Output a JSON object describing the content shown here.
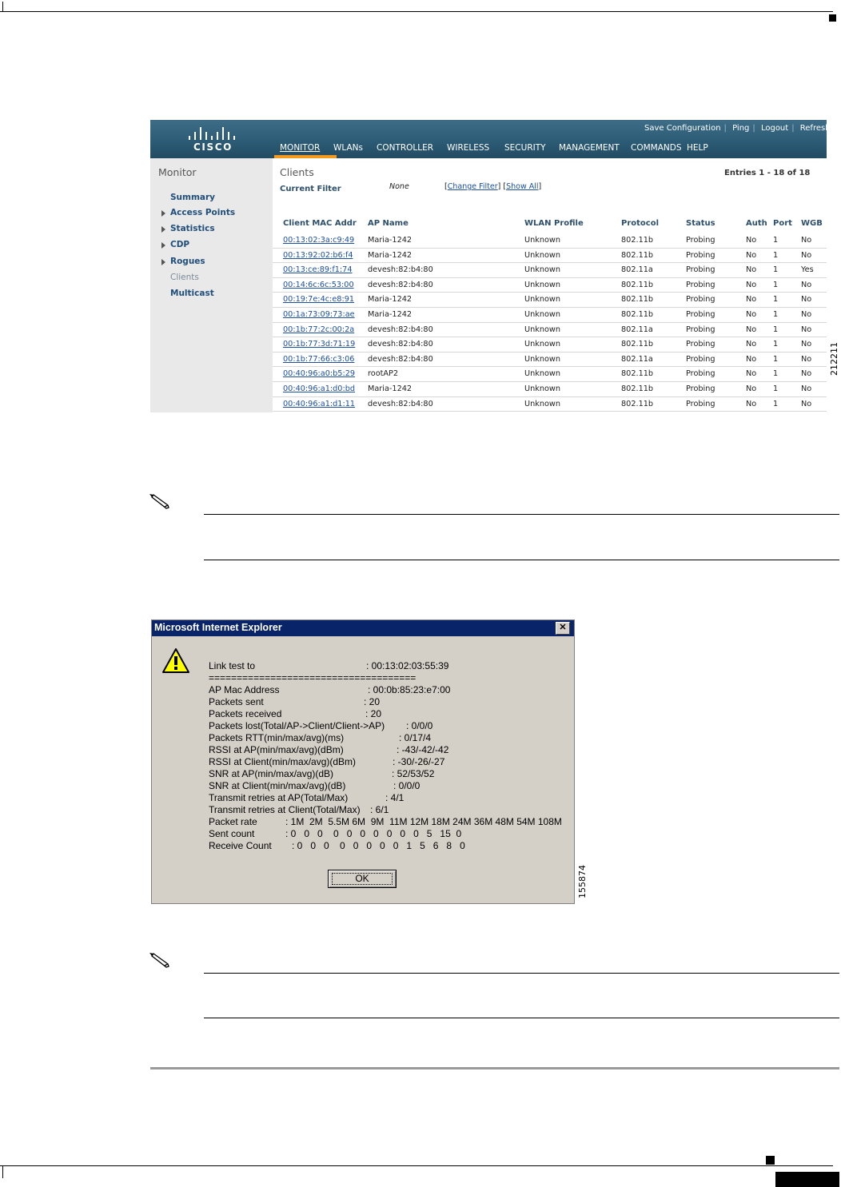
{
  "wlc": {
    "logo_text": "CISCO",
    "top_links": [
      "Save Configuration",
      "Ping",
      "Logout",
      "Refresh"
    ],
    "nav": [
      "MONITOR",
      "WLANs",
      "CONTROLLER",
      "WIRELESS",
      "SECURITY",
      "MANAGEMENT",
      "COMMANDS",
      "HELP"
    ],
    "sidebar": {
      "title": "Monitor",
      "items": [
        "Summary",
        "Access Points",
        "Statistics",
        "CDP",
        "Rogues",
        "Clients",
        "Multicast"
      ]
    },
    "main": {
      "title": "Clients",
      "entries": "Entries 1 - 18 of 18",
      "current_filter_label": "Current Filter",
      "current_filter_value": "None",
      "change_filter": "Change Filter",
      "show_all": "Show All"
    },
    "table": {
      "headers": [
        "Client MAC Addr",
        "AP Name",
        "WLAN Profile",
        "Protocol",
        "Status",
        "Auth",
        "Port",
        "WGB"
      ],
      "rows": [
        [
          "00:13:02:3a:c9:49",
          "Maria-1242",
          "Unknown",
          "802.11b",
          "Probing",
          "No",
          "1",
          "No"
        ],
        [
          "00:13:92:02:b6:f4",
          "Maria-1242",
          "Unknown",
          "802.11b",
          "Probing",
          "No",
          "1",
          "No"
        ],
        [
          "00:13:ce:89:f1:74",
          "devesh:82:b4:80",
          "Unknown",
          "802.11a",
          "Probing",
          "No",
          "1",
          "Yes"
        ],
        [
          "00:14:6c:6c:53:00",
          "devesh:82:b4:80",
          "Unknown",
          "802.11b",
          "Probing",
          "No",
          "1",
          "No"
        ],
        [
          "00:19:7e:4c:e8:91",
          "Maria-1242",
          "Unknown",
          "802.11b",
          "Probing",
          "No",
          "1",
          "No"
        ],
        [
          "00:1a:73:09:73:ae",
          "Maria-1242",
          "Unknown",
          "802.11b",
          "Probing",
          "No",
          "1",
          "No"
        ],
        [
          "00:1b:77:2c:00:2a",
          "devesh:82:b4:80",
          "Unknown",
          "802.11a",
          "Probing",
          "No",
          "1",
          "No"
        ],
        [
          "00:1b:77:3d:71:19",
          "devesh:82:b4:80",
          "Unknown",
          "802.11b",
          "Probing",
          "No",
          "1",
          "No"
        ],
        [
          "00:1b:77:66:c3:06",
          "devesh:82:b4:80",
          "Unknown",
          "802.11a",
          "Probing",
          "No",
          "1",
          "No"
        ],
        [
          "00:40:96:a0:b5:29",
          "rootAP2",
          "Unknown",
          "802.11b",
          "Probing",
          "No",
          "1",
          "No"
        ],
        [
          "00:40:96:a1:d0:bd",
          "Maria-1242",
          "Unknown",
          "802.11b",
          "Probing",
          "No",
          "1",
          "No"
        ],
        [
          "00:40:96:a1:d1:11",
          "devesh:82:b4:80",
          "Unknown",
          "802.11b",
          "Probing",
          "No",
          "1",
          "No"
        ]
      ]
    },
    "figure_number": "212211"
  },
  "dialog": {
    "title": "Microsoft Internet Explorer",
    "close": "✕",
    "lines": [
      {
        "label": "Link test to",
        "value": ": 00:13:02:03:55:39"
      },
      {
        "label": "=====================================",
        "value": ""
      },
      {
        "label": "AP Mac Address",
        "value": ": 00:0b:85:23:e7:00"
      },
      {
        "label": "Packets sent",
        "value": ": 20"
      },
      {
        "label": "Packets received",
        "value": ": 20"
      },
      {
        "label": "Packets lost(Total/AP->Client/Client->AP)",
        "value": ": 0/0/0"
      },
      {
        "label": " Packets RTT(min/max/avg)(ms)",
        "value": ": 0/17/4"
      },
      {
        "label": "RSSI at AP(min/max/avg)(dBm)",
        "value": ": -43/-42/-42"
      },
      {
        "label": "RSSI at Client(min/max/avg)(dBm)",
        "value": ": -30/-26/-27"
      },
      {
        "label": "SNR at AP(min/max/avg)(dB)",
        "value": ": 52/53/52"
      },
      {
        "label": "SNR at Client(min/max/avg)(dB)",
        "value": ": 0/0/0"
      },
      {
        "label": "Transmit retries at AP(Total/Max)",
        "value": ": 4/1"
      },
      {
        "label": "Transmit retries at Client(Total/Max)",
        "value": ": 6/1"
      },
      {
        "label": "Packet rate",
        "value": ": 1M  2M  5.5M 6M  9M  11M 12M 18M 24M 36M 48M 54M 108M"
      },
      {
        "label": "Sent count",
        "value": ": 0   0   0    0   0   0   0   0   0   0   5   15  0"
      },
      {
        "label": "Receive Count",
        "value": ": 0   0   0    0   0   0   0   0   1   5   6   8   0"
      }
    ],
    "ok_label": "OK",
    "figure_number": "155874"
  }
}
